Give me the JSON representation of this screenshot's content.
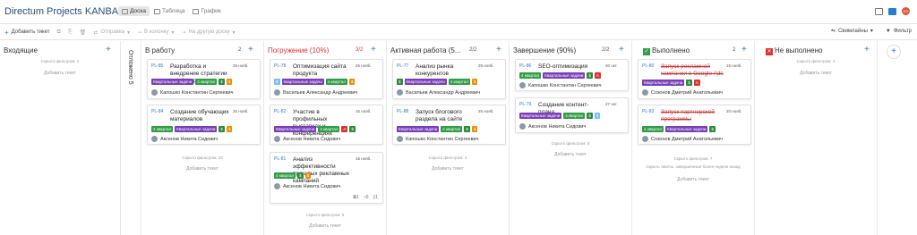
{
  "header": {
    "title": "Directum Projects KANBAN",
    "views": [
      "Доска",
      "Таблица",
      "График"
    ]
  },
  "toolbar": {
    "add_ticket": "Добавить тикет",
    "send": "Отправка",
    "to_column": "В колонку",
    "to_board": "На другую доску",
    "swimlanes": "Свимлайны",
    "filter": "Фильтр"
  },
  "columns": [
    {
      "title": "Входящие",
      "hidden": "Скрыто фильтром: 2",
      "add": "Добавить тикет"
    },
    {
      "title": "Отложено",
      "count": "5"
    },
    {
      "title": "В работу",
      "count": "2",
      "hidden": "Скрыто фильтром: 23",
      "add": "Добавить тикет"
    },
    {
      "title": "Погружение (10%)",
      "count": "3/2",
      "hidden": "Скрыто фильтром: 5",
      "add": "Добавить тикет"
    },
    {
      "title": "Активная работа (5...",
      "count": "2/2",
      "hidden": "Скрыто фильтром: 4",
      "add": "Добавить тикет"
    },
    {
      "title": "Завершение (90%)",
      "count": "2/2",
      "hidden": "Скрыто фильтром: 5",
      "add": "Добавить тикет"
    },
    {
      "title": "Выполнено",
      "count": "2",
      "hidden": "Скрыто фильтром: 7",
      "hidden2": "Скрыть тикеты, завершенные более недели назад",
      "add": "Добавить тикет"
    },
    {
      "title": "Не выполнено",
      "hidden": "Скрыто фильтром: 1",
      "add": "Добавить тикет"
    }
  ],
  "cards": [
    {
      "id": "PL-85",
      "title": "Разработка и внедрение стратегии email-маркетинга",
      "date": "25 нояб.",
      "person": "Капошко Константин Сергеевич",
      "tags": [
        "Квартальные задачи",
        "4 квартал",
        "$",
        "$"
      ]
    },
    {
      "id": "PL-84",
      "title": "Создание обучающих материалов",
      "date": "25 нояб.",
      "person": "Аксенов Никита Сидович",
      "tags": [
        "4 квартал",
        "Квартальные задачи",
        "$",
        "$"
      ]
    },
    {
      "id": "PL-78",
      "title": "Оптимизация сайта продукта",
      "date": "25 нояб.",
      "person": "Васильев Александр Андреевич",
      "tags": [
        "$",
        "Квартальные задачи",
        "4 квартал",
        "$"
      ]
    },
    {
      "id": "PL-82",
      "title": "Участие в профильных выставках и конференциях",
      "date": "15 нояб.",
      "person": "Аксенов Никита Сидович",
      "tags": [
        "Квартальные задачи",
        "4 квартал",
        "A",
        "$"
      ]
    },
    {
      "id": "PL-81",
      "title": "Анализ эффективности прошлых рекламных кампаний",
      "date": "15 нояб.",
      "person": "Аксенов Никита Сидович",
      "tags": [
        "4 квартал",
        "$",
        "$"
      ],
      "counts": [
        "1",
        "0",
        "1"
      ]
    },
    {
      "id": "PL-77",
      "title": "Анализ рынка конкурентов",
      "date": "29 нояб.",
      "person": "Васильев Александр Андреевич",
      "tags": [
        "$",
        "Квартальные задачи",
        "4 квартал",
        "$"
      ]
    },
    {
      "id": "PL-88",
      "title": "Запуск блогового раздела на сайте",
      "date": "25 нояб.",
      "person": "Капошко Константин Сергеевич",
      "tags": [
        "Квартальные задачи",
        "4 квартал",
        "$",
        "$"
      ]
    },
    {
      "id": "PL-86",
      "title": "SEO-оптимизация",
      "date": "20 окт.",
      "person": "Капошко Константин Сергеевич",
      "tags": [
        "4 квартал",
        "Квартальные задачи",
        "$",
        "A"
      ]
    },
    {
      "id": "PL-79",
      "title": "Создание контент-плана",
      "date": "27 окт.",
      "person": "Аксенов Никита Сидович",
      "tags": [
        "Квартальные задачи",
        "4 квартал",
        "$",
        "$"
      ]
    },
    {
      "id": "PL-80",
      "title": "Запуск рекламной кампании в Google Ads",
      "date": "15 нояб.",
      "person": "Созонов Дмитрий Анатольевич",
      "tags": [
        "Квартальные задачи",
        "$",
        "A"
      ]
    },
    {
      "id": "PL-83",
      "title": "Запуск партнерской программы",
      "date": "20 нояб.",
      "person": "Созонов Дмитрий Анатольевич",
      "tags": [
        "4 квартал",
        "Квартальные задачи",
        "$"
      ]
    }
  ]
}
